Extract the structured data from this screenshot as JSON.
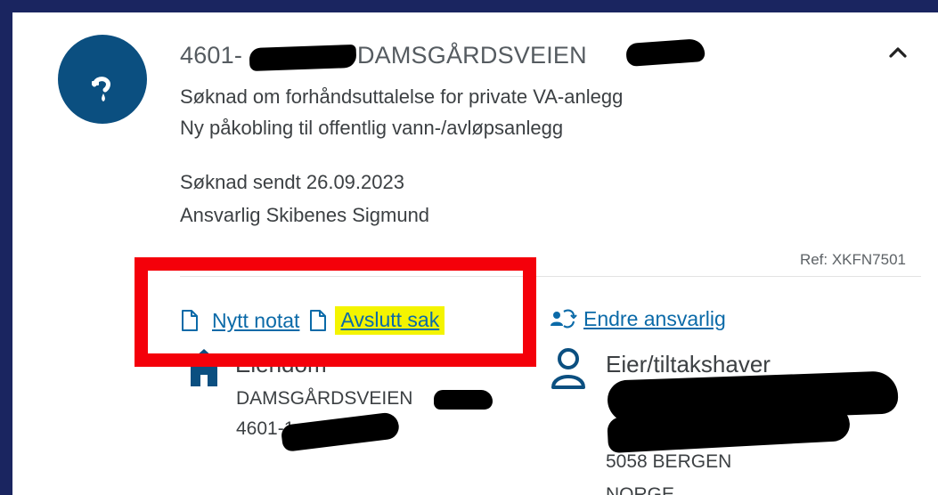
{
  "case": {
    "title_prefix": "4601-",
    "title_suffix": "- DAMSGÅRDSVEIEN",
    "subtitle_1": "Søknad om forhåndsuttalelse for private VA-anlegg",
    "subtitle_2": "Ny påkobling til offentlig vann-/avløpsanlegg",
    "sent": "Søknad sendt 26.09.2023",
    "responsible": "Ansvarlig Skibenes Sigmund",
    "ref": "Ref: XKFN7501"
  },
  "actions": {
    "new_note": "Nytt notat",
    "close_case": "Avslutt sak",
    "change_responsible": "Endre ansvarlig"
  },
  "property": {
    "heading": "Eiendom",
    "address": "DAMSGÅRDSVEIEN",
    "cadastre_prefix": "4601-1"
  },
  "owner": {
    "heading": "Eier/tiltakshaver",
    "postal": "5058 BERGEN",
    "country": "NORGE"
  },
  "colors": {
    "avatar": "#0b4f80",
    "link": "#0b6aa8",
    "highlight": "#f4f400",
    "annotation_box": "#f4000a"
  },
  "icons": {
    "case_icon": "water-tap-icon",
    "collapse": "chevron-up-icon",
    "note": "document-icon",
    "close": "document-icon",
    "change": "person-swap-icon",
    "property": "house-icon",
    "owner": "person-icon"
  }
}
